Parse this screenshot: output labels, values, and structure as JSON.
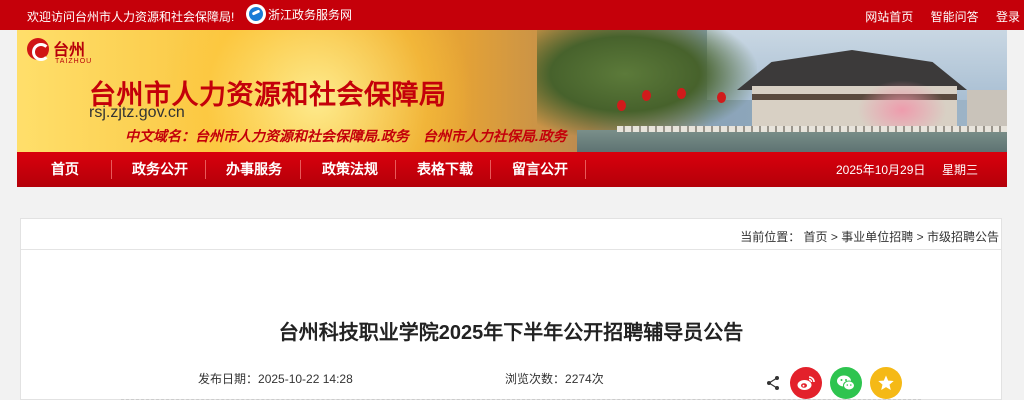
{
  "topbar": {
    "welcome": "欢迎访问台州市人力资源和社会保障局!",
    "zj_link": "浙江政务服务网",
    "links": [
      "网站首页",
      "智能问答",
      "登录"
    ]
  },
  "banner": {
    "logo_cn": "台州",
    "logo_en": "TAIZHOU",
    "title": "台州市人力资源和社会保障局",
    "domain": "rsj.zjtz.gov.cn",
    "cn_domain": "中文域名：台州市人力资源和社会保障局.政务　台州市人力社保局.政务"
  },
  "nav": {
    "items": [
      "首页",
      "政务公开",
      "办事服务",
      "政策法规",
      "表格下载",
      "留言公开"
    ],
    "date": "2025年10月29日",
    "weekday": "星期三"
  },
  "breadcrumb": {
    "prefix": "当前位置：",
    "items": [
      "首页",
      "事业单位招聘",
      "市级招聘公告"
    ],
    "separator": ">"
  },
  "article": {
    "title": "台州科技职业学院2025年下半年公开招聘辅导员公告",
    "publish_label": "发布日期：",
    "publish_date": "2025-10-22 14:28",
    "views_label": "浏览次数：",
    "views": "2274次"
  },
  "share": {
    "icons": [
      "share-icon",
      "weibo-icon",
      "wechat-icon",
      "favorite-icon"
    ],
    "colors": {
      "weibo": "#e3212b",
      "wechat": "#2ec44f",
      "favorite": "#f5b916"
    }
  },
  "theme": {
    "accent": "#c5000a"
  }
}
